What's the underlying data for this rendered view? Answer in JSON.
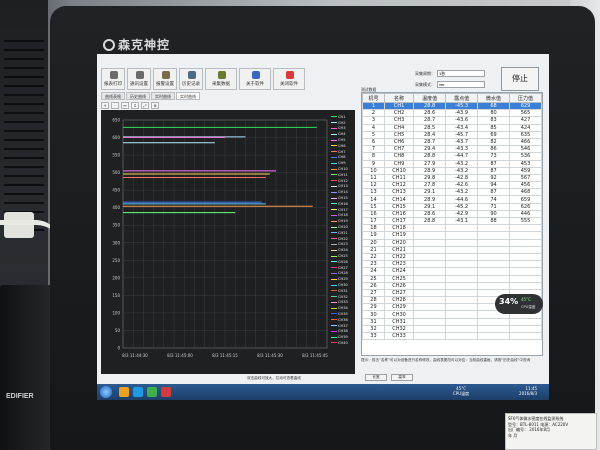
{
  "brand": "森克神控",
  "toolbar": {
    "buttons": [
      "报表打印",
      "通讯设置",
      "报警设置",
      "历史记录",
      "采集数据",
      "关于软件",
      "关闭软件"
    ],
    "colors": [
      "#6b6b6b",
      "#6b6b6b",
      "#7a6a4a",
      "#4d6b83",
      "#6a7a2f",
      "#3b66c4",
      "#d8393a"
    ],
    "icons": [
      "printer-icon",
      "settings-icon",
      "alarm-icon",
      "history-icon",
      "collect-icon",
      "info-icon",
      "power-icon"
    ]
  },
  "fields": {
    "row1_label": "采集周期：",
    "row1_value": "1秒",
    "row2_label": "采集模式：",
    "row2_value": "ver"
  },
  "stop_label": "停止",
  "tabs": [
    "曲线表格",
    "历史曲线",
    "实时曲线",
    "实时曲线"
  ],
  "active_tab": 3,
  "mini_tools": [
    "+",
    "-",
    "↔",
    "↕",
    "⤢",
    "⊕"
  ],
  "chart_data": {
    "type": "line",
    "y_ticks": [
      "650",
      "600",
      "550",
      "500",
      "450",
      "400",
      "350",
      "300",
      "250",
      "200",
      "150",
      "100",
      "50",
      "0"
    ],
    "x_ticks": [
      "8/3 11:44:30",
      "8/3 11:45:00",
      "8/3 11:45:15",
      "8/3 11:45:30",
      "8/3 11:45:45"
    ],
    "ylim": [
      0,
      650
    ],
    "series": [
      {
        "color": "#2ee05a",
        "y": 629,
        "x_start": 0.0,
        "x_end": 0.95
      },
      {
        "color": "#a8e4ff",
        "y": 602,
        "x_start": 0.0,
        "x_end": 0.6
      },
      {
        "color": "#ff6ad5",
        "y": 600,
        "x_start": 0.0,
        "x_end": 0.5
      },
      {
        "color": "#b2f0ff",
        "y": 585,
        "x_start": 0.0,
        "x_end": 0.45
      },
      {
        "color": "#ff77ff",
        "y": 505,
        "x_start": 0.0,
        "x_end": 0.75
      },
      {
        "color": "#ffd84d",
        "y": 496,
        "x_start": 0.0,
        "x_end": 0.72
      },
      {
        "color": "#ff7070",
        "y": 486,
        "x_start": 0.0,
        "x_end": 0.7
      },
      {
        "color": "#4d78ff",
        "y": 416,
        "x_start": 0.0,
        "x_end": 0.68
      },
      {
        "color": "#5bd3ff",
        "y": 411,
        "x_start": 0.0,
        "x_end": 0.7
      },
      {
        "color": "#ff9a4d",
        "y": 404,
        "x_start": 0.0,
        "x_end": 0.93
      },
      {
        "color": "#6dff7a",
        "y": 386,
        "x_start": 0.0,
        "x_end": 0.55
      }
    ],
    "legend": [
      "CH1",
      "CH2",
      "CH3",
      "CH4",
      "CH5",
      "CH6",
      "CH7",
      "CH8",
      "CH9",
      "CH10",
      "CH11",
      "CH12",
      "CH13",
      "CH14",
      "CH15",
      "CH16",
      "CH17",
      "CH18",
      "CH19",
      "CH20",
      "CH21",
      "CH22",
      "CH23",
      "CH24",
      "CH25",
      "CH26",
      "CH27",
      "CH28",
      "CH29",
      "CH30",
      "CH31",
      "CH32",
      "CH33",
      "CH34",
      "CH35",
      "CH36",
      "CH37",
      "CH38",
      "CH39",
      "CH40"
    ],
    "legend_colors": [
      "#2ee05a",
      "#a8e4ff",
      "#ff6ad5",
      "#b2f0ff",
      "#ff77ff",
      "#ffd84d",
      "#ff7070",
      "#4d78ff",
      "#5bd3ff",
      "#ff9a4d",
      "#6dff7a",
      "#ff4d4d",
      "#e6e6e6",
      "#8f8fff",
      "#ffb3e6",
      "#66ffd9",
      "#ffff66",
      "#c266ff",
      "#ff9966",
      "#99ff99",
      "#66b3ff",
      "#ff66a3",
      "#b3b3b3",
      "#ffd9b3",
      "#a3ff66",
      "#66ffff",
      "#ff3399",
      "#9966ff",
      "#ffcc33",
      "#33ccff",
      "#cc6633",
      "#66cc99",
      "#ff99cc",
      "#cccc33",
      "#3366ff",
      "#ff6633",
      "#99ccff",
      "#cc33ff",
      "#33ff99",
      "#ff3366"
    ]
  },
  "table": {
    "title": "测试数据",
    "headers": [
      "机号",
      "名称",
      "温度值",
      "露点值",
      "微水值",
      "压力值"
    ],
    "rows": [
      [
        "1",
        "CH1",
        "28.8",
        "-45.3",
        "68",
        "629"
      ],
      [
        "2",
        "CH2",
        "28.6",
        "-43.9",
        "80",
        "565"
      ],
      [
        "3",
        "CH3",
        "28.7",
        "-43.6",
        "83",
        "427"
      ],
      [
        "4",
        "CH4",
        "28.5",
        "-43.4",
        "85",
        "424"
      ],
      [
        "5",
        "CH5",
        "28.4",
        "-45.7",
        "69",
        "635"
      ],
      [
        "6",
        "CH6",
        "28.7",
        "-43.7",
        "82",
        "466"
      ],
      [
        "7",
        "CH7",
        "29.4",
        "-43.3",
        "86",
        "546"
      ],
      [
        "8",
        "CH8",
        "28.8",
        "-44.7",
        "73",
        "536"
      ],
      [
        "9",
        "CH9",
        "27.9",
        "-43.2",
        "87",
        "453"
      ],
      [
        "10",
        "CH10",
        "28.9",
        "-43.2",
        "87",
        "459"
      ],
      [
        "11",
        "CH11",
        "29.8",
        "-42.8",
        "92",
        "567"
      ],
      [
        "12",
        "CH12",
        "27.8",
        "-42.6",
        "94",
        "456"
      ],
      [
        "13",
        "CH13",
        "29.1",
        "-43.2",
        "87",
        "468"
      ],
      [
        "14",
        "CH14",
        "28.9",
        "-44.6",
        "74",
        "659"
      ],
      [
        "15",
        "CH15",
        "29.1",
        "-45.2",
        "71",
        "626"
      ],
      [
        "16",
        "CH16",
        "28.6",
        "-42.9",
        "90",
        "446"
      ],
      [
        "17",
        "CH17",
        "28.8",
        "-43.1",
        "88",
        "555"
      ],
      [
        "18",
        "CH18",
        "",
        "",
        "",
        ""
      ],
      [
        "19",
        "CH19",
        "",
        "",
        "",
        ""
      ],
      [
        "20",
        "CH20",
        "",
        "",
        "",
        ""
      ],
      [
        "21",
        "CH21",
        "",
        "",
        "",
        ""
      ],
      [
        "22",
        "CH22",
        "",
        "",
        "",
        ""
      ],
      [
        "23",
        "CH23",
        "",
        "",
        "",
        ""
      ],
      [
        "24",
        "CH24",
        "",
        "",
        "",
        ""
      ],
      [
        "25",
        "CH25",
        "",
        "",
        "",
        ""
      ],
      [
        "26",
        "CH26",
        "",
        "",
        "",
        ""
      ],
      [
        "27",
        "CH27",
        "",
        "",
        "",
        ""
      ],
      [
        "28",
        "CH28",
        "",
        "",
        "",
        ""
      ],
      [
        "29",
        "CH29",
        "",
        "",
        "",
        ""
      ],
      [
        "30",
        "CH30",
        "",
        "",
        "",
        ""
      ],
      [
        "31",
        "CH31",
        "",
        "",
        "",
        ""
      ],
      [
        "32",
        "CH32",
        "",
        "",
        "",
        ""
      ],
      [
        "33",
        "CH33",
        "",
        "",
        "",
        ""
      ]
    ],
    "selected_row": 0
  },
  "note": "提示：双击“名称”可以对设备进行名称修改，曲线表更改可以对应：当前曲线重画，请按“历史曲线”中查询",
  "bottom_buttons": [
    "长宽",
    "高窄"
  ],
  "chart_footer": "双击曲线可放大，拉动可查看曲线",
  "gauge": {
    "value": "34%",
    "temp": "45°C",
    "label": "CPU温度"
  },
  "taskbar": {
    "temp": "45°C",
    "temp_label": "CPU温度",
    "time": "11:45",
    "date": "2016/8/3",
    "apps": [
      "#f0a020",
      "#1d9ae0",
      "#3fae4e",
      "#d33c3c"
    ]
  },
  "sticker": {
    "line1": "SF6气体微水密度在线监测系统",
    "line2": "型号：BTL-8011   电源：AC220V",
    "line3": "出厂编号：    2016年8月",
    "line4": "年    月"
  }
}
